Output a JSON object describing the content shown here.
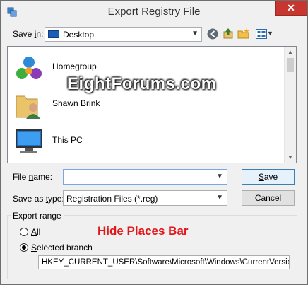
{
  "window": {
    "title": "Export Registry File",
    "close_glyph": "✕"
  },
  "save_in": {
    "label_prefix": "Save ",
    "label_accel": "i",
    "label_suffix": "n:",
    "location": "Desktop"
  },
  "toolbar": {
    "icons": [
      "back-icon",
      "up-folder-icon",
      "new-folder-icon",
      "view-menu-icon"
    ]
  },
  "file_list": {
    "items": [
      {
        "label": "Homegroup",
        "icon": "homegroup-icon"
      },
      {
        "label": "Shawn Brink",
        "icon": "user-folder-icon"
      },
      {
        "label": "This PC",
        "icon": "computer-icon"
      }
    ]
  },
  "watermark": "EightForums.com",
  "file_name": {
    "label_prefix": "File ",
    "label_accel": "n",
    "label_suffix": "ame:",
    "value": ""
  },
  "save_as_type": {
    "label_prefix": "Save as ",
    "label_accel": "t",
    "label_suffix": "ype:",
    "value": "Registration Files (*.reg)"
  },
  "buttons": {
    "save_accel": "S",
    "save_rest": "ave",
    "cancel": "Cancel"
  },
  "export_range": {
    "title": "Export range",
    "all_accel": "A",
    "all_rest": "ll",
    "branch_accel": "S",
    "branch_rest": "elected branch",
    "branch_value": "HKEY_CURRENT_USER\\Software\\Microsoft\\Windows\\CurrentVersion\\Policies"
  },
  "annotation": "Hide Places Bar",
  "colors": {
    "annotation": "#e3161b",
    "close": "#c7372f",
    "accent": "#3c7fb1"
  }
}
